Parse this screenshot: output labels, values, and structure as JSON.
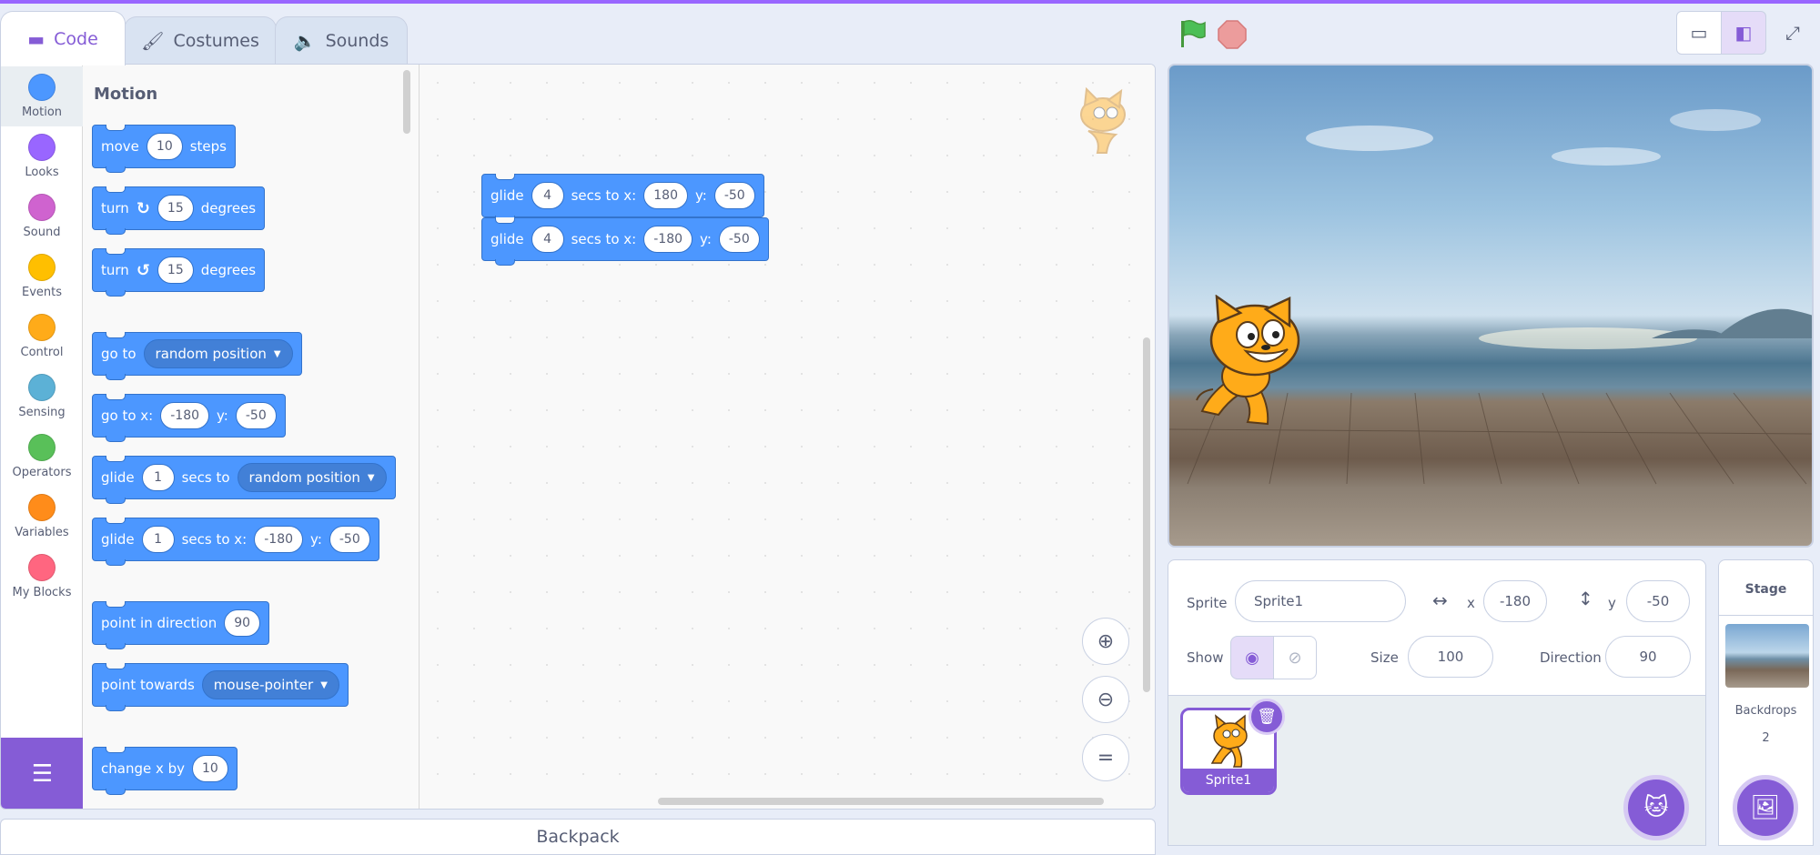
{
  "tabs": {
    "code": "Code",
    "costumes": "Costumes",
    "sounds": "Sounds"
  },
  "categories": [
    {
      "label": "Motion",
      "color": "#4c97ff"
    },
    {
      "label": "Looks",
      "color": "#9966ff"
    },
    {
      "label": "Sound",
      "color": "#cf63cf"
    },
    {
      "label": "Events",
      "color": "#ffbf00"
    },
    {
      "label": "Control",
      "color": "#ffab19"
    },
    {
      "label": "Sensing",
      "color": "#5cb1d6"
    },
    {
      "label": "Operators",
      "color": "#59c059"
    },
    {
      "label": "Variables",
      "color": "#ff8c1a"
    },
    {
      "label": "My Blocks",
      "color": "#ff6680"
    }
  ],
  "palette": {
    "title": "Motion",
    "move": {
      "word": "move",
      "steps": "10",
      "unit": "steps"
    },
    "turn_right": {
      "word": "turn",
      "degrees": "15",
      "unit": "degrees"
    },
    "turn_left": {
      "word": "turn",
      "degrees": "15",
      "unit": "degrees"
    },
    "goto": {
      "word": "go to",
      "target": "random position"
    },
    "goto_xy": {
      "word": "go to x:",
      "x": "-180",
      "ylabel": "y:",
      "y": "-50"
    },
    "glide_to": {
      "word": "glide",
      "secs": "1",
      "mid": "secs to",
      "target": "random position"
    },
    "glide_xy": {
      "word": "glide",
      "secs": "1",
      "mid": "secs to x:",
      "x": "-180",
      "ylabel": "y:",
      "y": "-50"
    },
    "point_dir": {
      "word": "point in direction",
      "dir": "90"
    },
    "point_towards": {
      "word": "point towards",
      "target": "mouse-pointer"
    },
    "change_x": {
      "word": "change x by",
      "value": "10"
    }
  },
  "workspace": {
    "glide1": {
      "word": "glide",
      "secs": "4",
      "mid": "secs to x:",
      "x": "180",
      "ylabel": "y:",
      "y": "-50"
    },
    "glide2": {
      "word": "glide",
      "secs": "4",
      "mid": "secs to x:",
      "x": "-180",
      "ylabel": "y:",
      "y": "-50"
    }
  },
  "backpack": "Backpack",
  "sprite_info": {
    "sprite_label": "Sprite",
    "sprite_name": "Sprite1",
    "x_label": "x",
    "x": "-180",
    "y_label": "y",
    "y": "-50",
    "show_label": "Show",
    "size_label": "Size",
    "size": "100",
    "direction_label": "Direction",
    "direction": "90"
  },
  "sprites": [
    {
      "name": "Sprite1"
    }
  ],
  "stage_panel": {
    "title": "Stage",
    "backdrops_label": "Backdrops",
    "backdrops_count": "2"
  },
  "colors": {
    "accent": "#855cd6",
    "motion": "#4c97ff",
    "flag": "#4cbf56",
    "stop": "#ec9c9c"
  }
}
